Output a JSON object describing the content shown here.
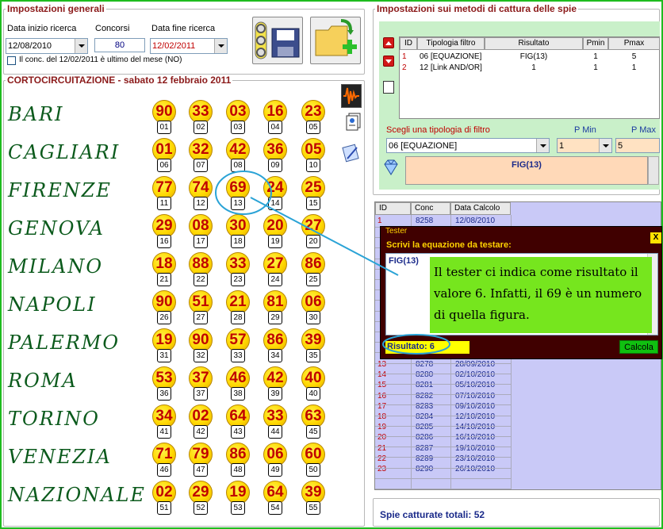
{
  "general": {
    "legend": "Impostazioni generali",
    "start_label": "Data inizio ricerca",
    "start_value": "12/08/2010",
    "count_label": "Concorsi",
    "count_value": "80",
    "end_label": "Data fine ricerca",
    "end_value": "12/02/2011",
    "check_label": "Il conc. del 12/02/2011 è ultimo del mese (NO)"
  },
  "short": {
    "title": "CORTOCIRCUITAZIONE - sabato 12 febbraio 2011"
  },
  "wheels": [
    {
      "city": "BARI",
      "nums": [
        "90",
        "33",
        "03",
        "16",
        "23"
      ],
      "pos": [
        "01",
        "02",
        "03",
        "04",
        "05"
      ]
    },
    {
      "city": "CAGLIARI",
      "nums": [
        "01",
        "32",
        "42",
        "36",
        "05"
      ],
      "pos": [
        "06",
        "07",
        "08",
        "09",
        "10"
      ]
    },
    {
      "city": "FIRENZE",
      "nums": [
        "77",
        "74",
        "69",
        "24",
        "25"
      ],
      "pos": [
        "11",
        "12",
        "13",
        "14",
        "15"
      ]
    },
    {
      "city": "GENOVA",
      "nums": [
        "29",
        "08",
        "30",
        "20",
        "27"
      ],
      "pos": [
        "16",
        "17",
        "18",
        "19",
        "20"
      ]
    },
    {
      "city": "MILANO",
      "nums": [
        "18",
        "88",
        "33",
        "27",
        "86"
      ],
      "pos": [
        "21",
        "22",
        "23",
        "24",
        "25"
      ]
    },
    {
      "city": "NAPOLI",
      "nums": [
        "90",
        "51",
        "21",
        "81",
        "06"
      ],
      "pos": [
        "26",
        "27",
        "28",
        "29",
        "30"
      ]
    },
    {
      "city": "PALERMO",
      "nums": [
        "19",
        "90",
        "57",
        "86",
        "39"
      ],
      "pos": [
        "31",
        "32",
        "33",
        "34",
        "35"
      ]
    },
    {
      "city": "ROMA",
      "nums": [
        "53",
        "37",
        "46",
        "42",
        "40"
      ],
      "pos": [
        "36",
        "37",
        "38",
        "39",
        "40"
      ]
    },
    {
      "city": "TORINO",
      "nums": [
        "34",
        "02",
        "64",
        "33",
        "63"
      ],
      "pos": [
        "41",
        "42",
        "43",
        "44",
        "45"
      ]
    },
    {
      "city": "VENEZIA",
      "nums": [
        "71",
        "79",
        "86",
        "06",
        "60"
      ],
      "pos": [
        "46",
        "47",
        "48",
        "49",
        "50"
      ]
    },
    {
      "city": "NAZIONALE",
      "nums": [
        "02",
        "29",
        "19",
        "64",
        "39"
      ],
      "pos": [
        "51",
        "52",
        "53",
        "54",
        "55"
      ]
    }
  ],
  "methods": {
    "legend": "Impostazioni sui metodi di cattura delle spie",
    "headers": [
      "ID",
      "Tipologia filtro",
      "Risultato",
      "Pmin",
      "Pmax"
    ],
    "rows": [
      [
        "1",
        "06 [EQUAZIONE]",
        "FIG(13)",
        "1",
        "5"
      ],
      [
        "2",
        "12 [Link AND/OR]",
        "1",
        "1",
        "1"
      ]
    ],
    "filter_label": "Scegli una tipologia di filtro",
    "pmin_label": "P Min",
    "pmax_label": "P Max",
    "filter_value": "06 [EQUAZIONE]",
    "pmin_value": "1",
    "pmax_value": "5",
    "formula": "FIG(13)"
  },
  "conc": {
    "headers": [
      "ID",
      "Conc",
      "Data Calcolo"
    ],
    "top": [
      [
        "1",
        "8258",
        "12/08/2010"
      ]
    ],
    "rows": [
      [
        "13",
        "8278",
        "28/09/2010"
      ],
      [
        "14",
        "8280",
        "02/10/2010"
      ],
      [
        "15",
        "8281",
        "05/10/2010"
      ],
      [
        "16",
        "8282",
        "07/10/2010"
      ],
      [
        "17",
        "8283",
        "09/10/2010"
      ],
      [
        "18",
        "8284",
        "12/10/2010"
      ],
      [
        "19",
        "8285",
        "14/10/2010"
      ],
      [
        "20",
        "8286",
        "16/10/2010"
      ],
      [
        "21",
        "8287",
        "19/10/2010"
      ],
      [
        "22",
        "8289",
        "23/10/2010"
      ],
      [
        "23",
        "8290",
        "26/10/2010"
      ]
    ]
  },
  "tester": {
    "title": "Tester",
    "close": "X",
    "prompt": "Scrivi la equazione da testare:",
    "equation": "FIG(13)",
    "note": "Il tester ci indica come risultato il valore 6. Infatti, il 69 è un numero di quella figura.",
    "result": "Risultato: 6",
    "button": "Calcola"
  },
  "total": {
    "text": "Spie catturate totali: 52"
  }
}
